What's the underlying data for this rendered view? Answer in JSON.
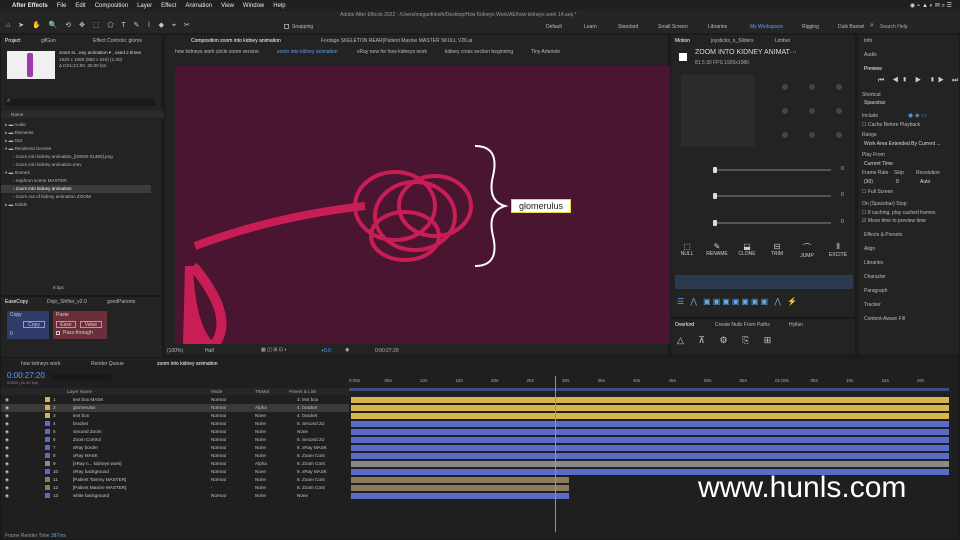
{
  "menubar": {
    "app": "After Effects",
    "items": [
      "File",
      "Edit",
      "Composition",
      "Layer",
      "Effect",
      "Animation",
      "View",
      "Window",
      "Help"
    ],
    "title": "Adobe After Effects 2022 - /Users/meganfriesth/Desktop/How Kidneys Work/AE/how kidneys work 14.aep *"
  },
  "toolbar": {
    "snapping": "Snapping",
    "workspaces": [
      "Default",
      "Learn",
      "Standard",
      "Small Screen",
      "Libraries",
      "My Workspace",
      "Rigging",
      "Duik Bassel"
    ],
    "search": "Search Help"
  },
  "project": {
    "tab": "Project",
    "tab2": "gifGun",
    "tab3": "Effect Controls: glome",
    "comp_name": "zoom in...ney animation ▾ , used 2 times",
    "comp_size": "1920 x 1080 (960 x 540) (1.00)",
    "comp_duration": "Δ 0;01;21;00, 30.00 fps",
    "col_name": "Name",
    "items": [
      "Audio",
      "Elements",
      "Out",
      "Rendered Scenes",
      "zoom into kidney animation_[00000-01350].png",
      "zoom into kidney animation.mov",
      "Scenes",
      "nephron scene MASTER",
      "zoom into kidney animation",
      "zoom out of kidney animation ZOOM",
      "Solids"
    ],
    "bpc": "8 bpc"
  },
  "easecopy": {
    "tab1": "EaseCopy",
    "tab2": "Dojo_Shifter_v2.0",
    "tab3": "goodParents",
    "copy_label": "Copy",
    "copy_btn": "Copy",
    "paste_label": "Paste",
    "ease_btn": "Ease",
    "value_btn": "Value",
    "pass_through": "Pass-through",
    "zero": "0"
  },
  "comp": {
    "tabs": [
      "Composition zoom into kidney animation",
      "Footage SKELETON REAR(Patient Maxine MASTER SKULL V26.ai"
    ],
    "breadcrumbs": [
      "how kidneys work circle zoom version",
      "zoom into kidney animation",
      "xRay new for how kidneys work",
      "kidney cross section beginning",
      "Tiny Arteriole"
    ],
    "label_text": "glomerulus",
    "zoom": "(100%)",
    "quality": "Half",
    "exposure": "+0.0",
    "timecode": "0:00:27:20"
  },
  "motion": {
    "tab1": "Motion",
    "tab2": "joysticks_n_Sliders",
    "tab3": "Limber",
    "title": "ZOOM INTO KIDNEY ANIMAT···",
    "info": "81.5   30 FPS   1920x1080",
    "slider_vals": [
      "0",
      "0",
      "0"
    ],
    "buttons": [
      "NULL",
      "RENAME",
      "CLONE",
      "TRIM",
      "JUMP",
      "EXCITE"
    ]
  },
  "overlord": {
    "tab1": "Overlord",
    "tab2": "Create Nulls From Paths",
    "tab3": "Hyllan"
  },
  "right": {
    "info": "Info",
    "audio": "Audio",
    "preview": "Preview",
    "shortcut_label": "Shortcut",
    "shortcut": "Spacebar",
    "include": "Include",
    "cache": "Cache Before Playback",
    "range_label": "Range",
    "range": "Work Area Extended By Current ...",
    "playfrom_label": "Play From",
    "playfrom": "Current Time",
    "framerate_label": "Frame Rate",
    "skip_label": "Skip",
    "res_label": "Resolution",
    "framerate": "(30)",
    "skip": "0",
    "res": "Auto",
    "fullscreen": "Full Screen",
    "on_stop": "On (Spacebar) Stop:",
    "if_caching": "If caching, play cached frames",
    "move_time": "Move time to preview time",
    "panels": [
      "Effects & Presets",
      "Align",
      "Libraries",
      "Character",
      "Paragraph",
      "Tracker",
      "Content-Aware Fill"
    ]
  },
  "timeline": {
    "tabs": [
      "how kidneys work",
      "Render Queue",
      "zoom into kidney animation"
    ],
    "timecode": "0:00:27:20",
    "timecode_sub": "00830 (30.00 fps)",
    "col_layer": "Layer Name",
    "col_mode": "Mode",
    "col_trk": "TrkMat",
    "col_parent": "Parent & Link",
    "ruler": [
      "0:00s",
      "05s",
      "10s",
      "15s",
      "20s",
      "25s",
      "30s",
      "35s",
      "40s",
      "45s",
      "50s",
      "55s",
      "01:00s",
      "05s",
      "10s",
      "15s",
      "20s"
    ],
    "frame_render_label": "Frame Render Time",
    "frame_render": "387ms",
    "layers": [
      {
        "n": "1",
        "name": "text box MASK",
        "mode": "Normal",
        "trk": "",
        "parent": "3. text box",
        "color": "#d8b54a"
      },
      {
        "n": "2",
        "name": "glomerulus",
        "mode": "Normal",
        "trk": "Alpha",
        "parent": "4. bracket",
        "color": "#d8b54a"
      },
      {
        "n": "3",
        "name": "text box",
        "mode": "Normal",
        "trk": "None",
        "parent": "4. bracket",
        "color": "#d8b54a"
      },
      {
        "n": "4",
        "name": "bracket",
        "mode": "Normal",
        "trk": "None",
        "parent": "5. Second Zo",
        "color": "#5a6bc9"
      },
      {
        "n": "5",
        "name": "Second Zoom",
        "mode": "Normal",
        "trk": "None",
        "parent": "None",
        "color": "#5a6bc9"
      },
      {
        "n": "6",
        "name": "Zoom Control",
        "mode": "Normal",
        "trk": "None",
        "parent": "5. Second Zo",
        "color": "#5a6bc9"
      },
      {
        "n": "7",
        "name": "xRay border",
        "mode": "Normal",
        "trk": "None",
        "parent": "8. xRay MASK",
        "color": "#5a6bc9"
      },
      {
        "n": "8",
        "name": "xRay MASK",
        "mode": "Normal",
        "trk": "None",
        "parent": "6. Zoom Cont",
        "color": "#5a6bc9"
      },
      {
        "n": "9",
        "name": "[xRay n... kidneys work]",
        "mode": "Normal",
        "trk": "Alpha",
        "parent": "6. Zoom Cont",
        "color": "#8a8a8a"
      },
      {
        "n": "10",
        "name": "xRay background",
        "mode": "Normal",
        "trk": "None",
        "parent": "8. xRay MASK",
        "color": "#5a6bc9"
      },
      {
        "n": "11",
        "name": "[Patient Tammy MASTER]",
        "mode": "Normal",
        "trk": "None",
        "parent": "6. Zoom Cont",
        "color": "#8a7c60"
      },
      {
        "n": "12",
        "name": "[Patient Maxine MASTER]",
        "mode": "-",
        "trk": "None",
        "parent": "6. Zoom Cont",
        "color": "#8a7c60"
      },
      {
        "n": "13",
        "name": "white background",
        "mode": "Normal",
        "trk": "None",
        "parent": "None",
        "color": "#5a6bc9"
      }
    ]
  },
  "watermark": "www.hunls.com"
}
